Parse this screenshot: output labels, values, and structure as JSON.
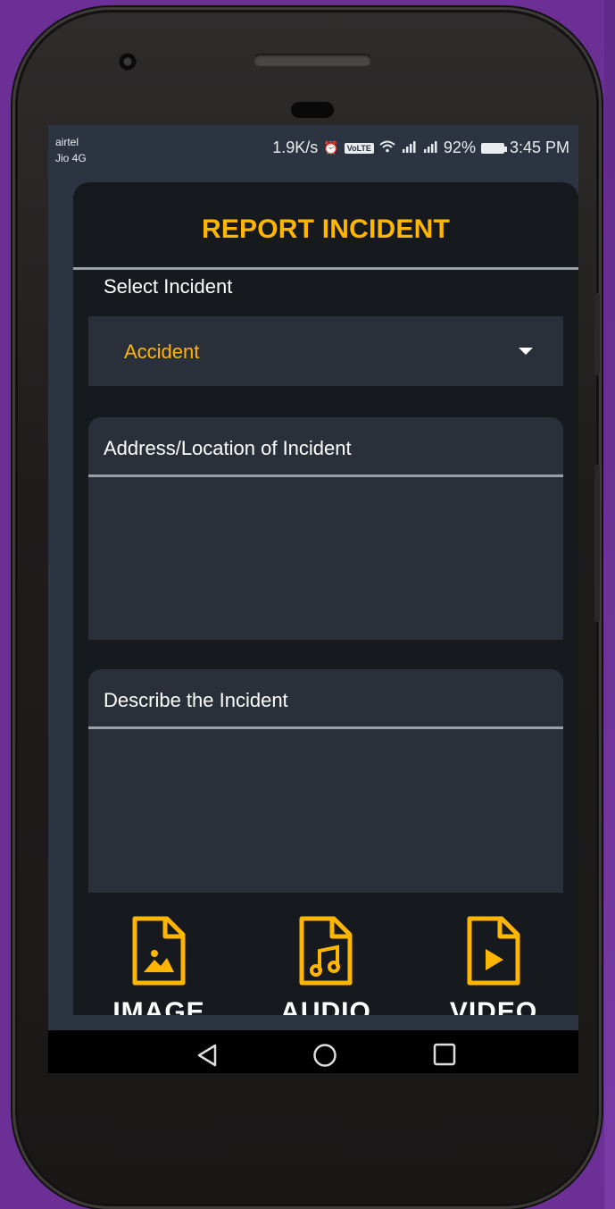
{
  "status_bar": {
    "carrier_primary": "airtel",
    "carrier_secondary": "Jio 4G",
    "net_speed": "1.9K/s",
    "volte_badge": "VoLTE",
    "battery_percent": "92%",
    "time": "3:45 PM"
  },
  "header": {
    "title": "REPORT INCIDENT"
  },
  "incident_select": {
    "label": "Select Incident",
    "selected_value": "Accident"
  },
  "address_field": {
    "label": "Address/Location of Incident",
    "value": ""
  },
  "description_field": {
    "label": "Describe the Incident",
    "value": ""
  },
  "attachments": [
    {
      "label": "IMAGE",
      "icon": "image-file-icon"
    },
    {
      "label": "AUDIO",
      "icon": "audio-file-icon"
    },
    {
      "label": "VIDEO",
      "icon": "video-file-icon"
    }
  ],
  "colors": {
    "accent": "#ffb600",
    "card_background": "#16191e",
    "field_background": "#29303a",
    "status_background": "#2b3440",
    "device_frame": "#2a2827",
    "wallpaper": "#6b2f96"
  }
}
